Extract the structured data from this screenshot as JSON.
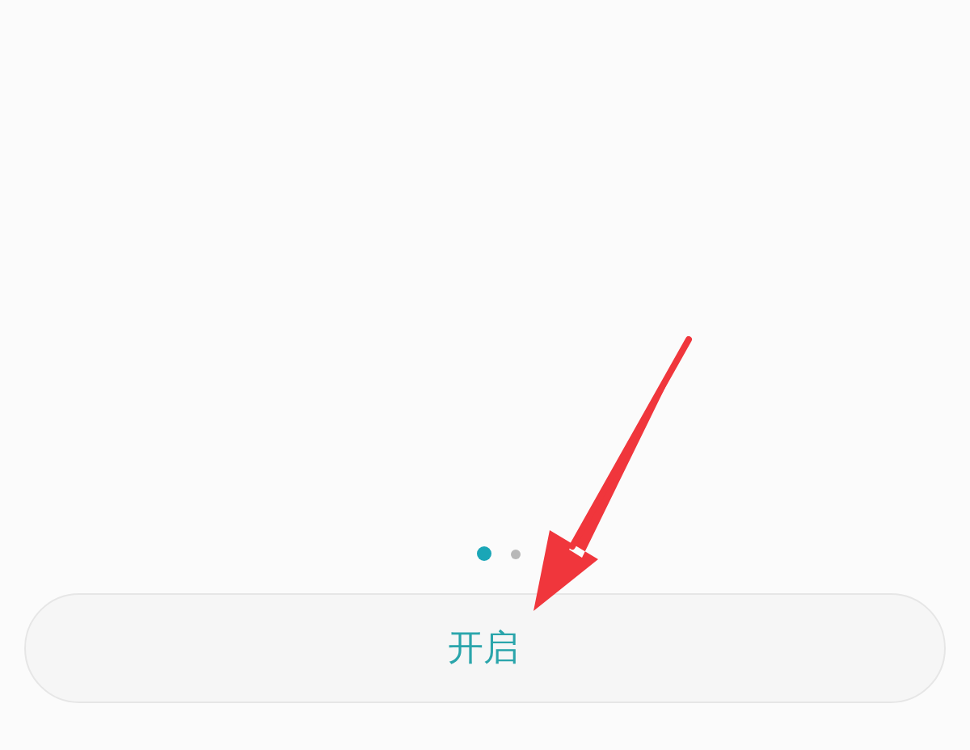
{
  "page_dots": [
    {
      "selected": true
    },
    {
      "selected": false
    }
  ],
  "button": {
    "label": "开启"
  }
}
